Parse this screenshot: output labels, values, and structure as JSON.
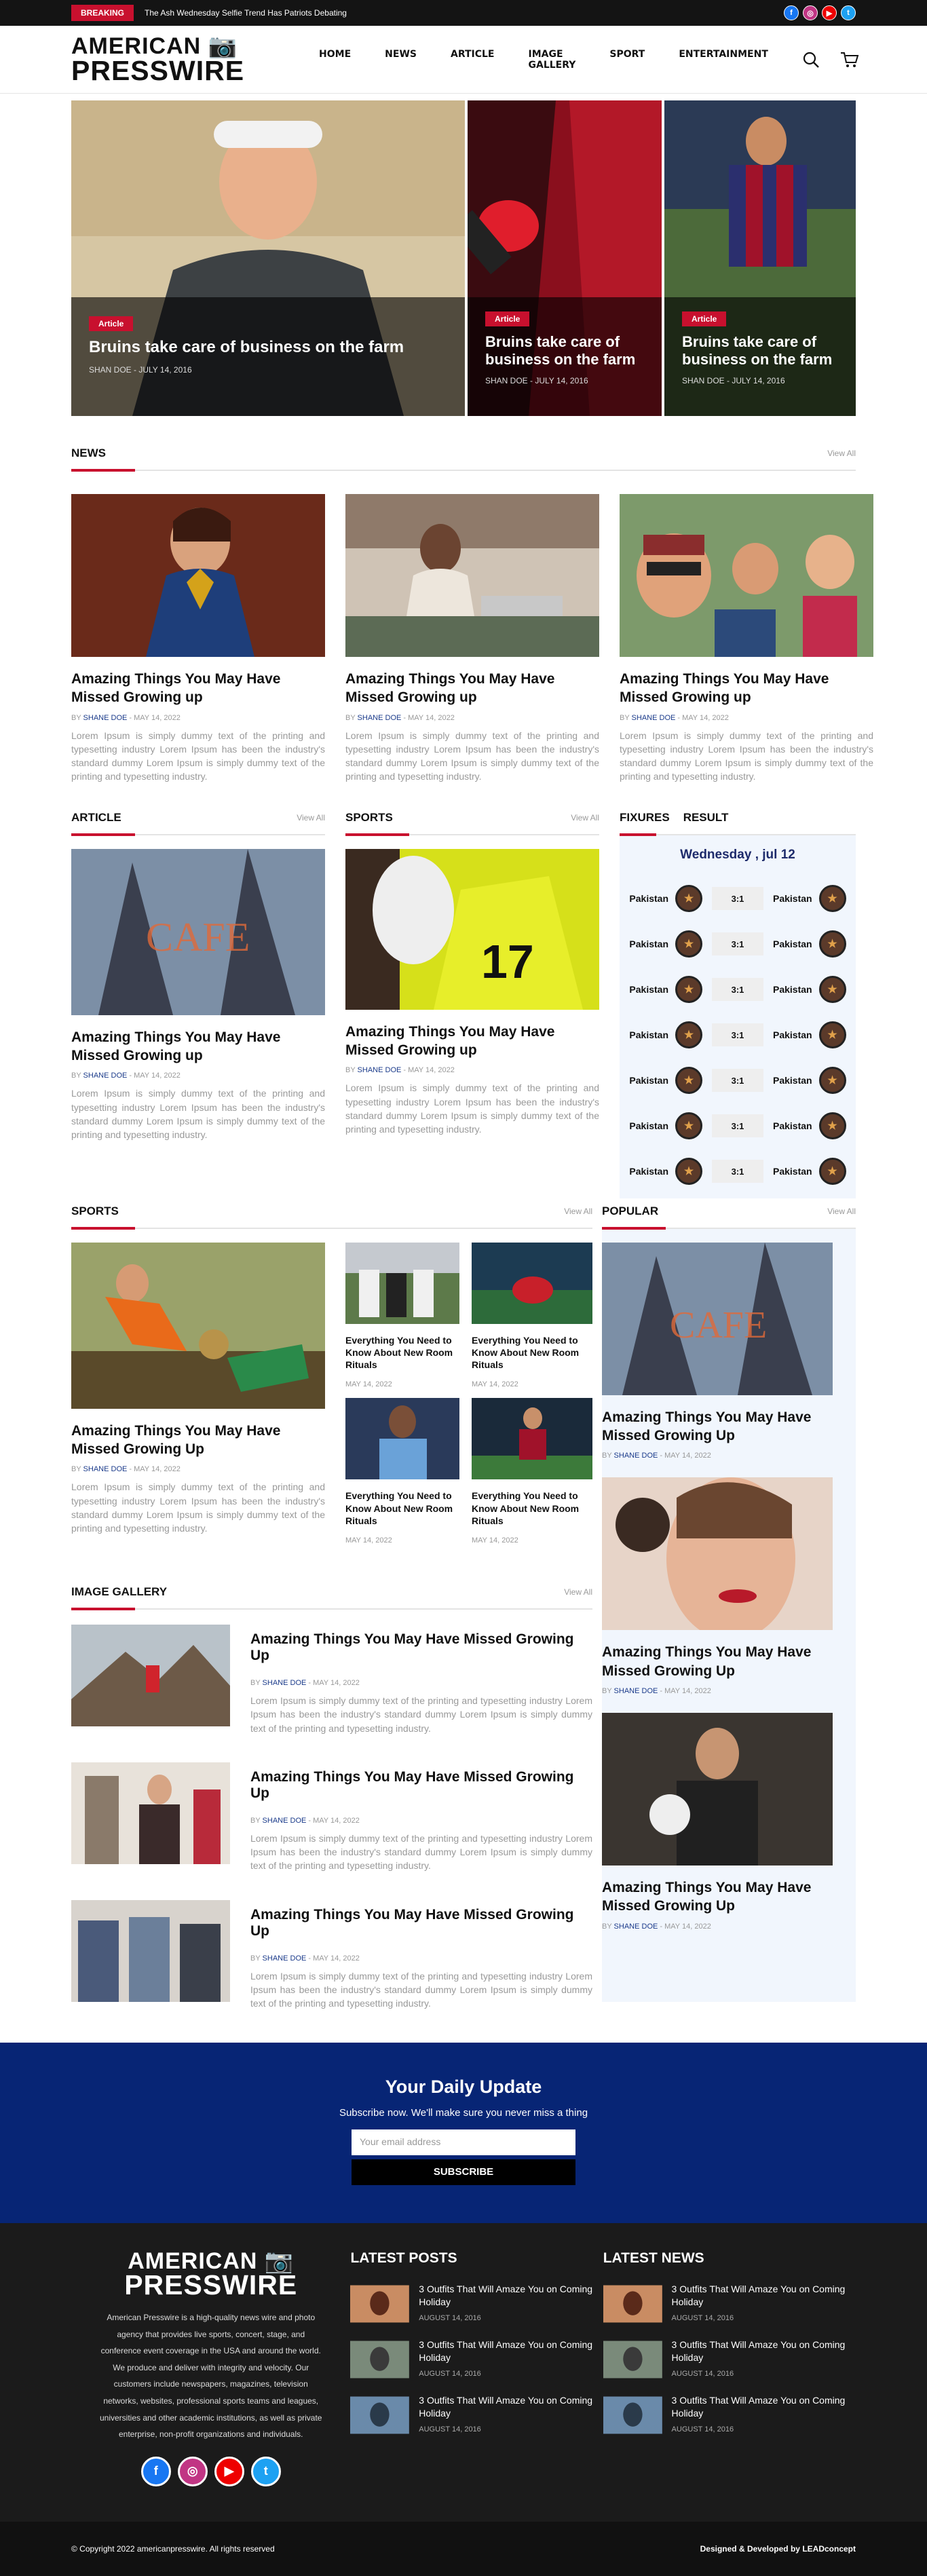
{
  "topbar": {
    "breaking": "BREAKING",
    "ticker": "The Ash Wednesday Selfie Trend Has Patriots Debating",
    "socials": [
      "f",
      "ig",
      "yt",
      "tw"
    ]
  },
  "brand": {
    "line1": "AMERICAN",
    "line2": "PRESSWIRE",
    "accent": "#c8102e",
    "navy": "#072575"
  },
  "nav": [
    "HOME",
    "NEWS",
    "ARTICLE",
    "IMAGE GALLERY",
    "SPORT",
    "ENTERTAINMENT"
  ],
  "header_icons": [
    "search-icon",
    "cart-icon"
  ],
  "hero": [
    {
      "tag": "Article",
      "title": "Bruins take care of business on the farm",
      "meta": "SHAN DOE - JULY 14, 2016"
    },
    {
      "tag": "Article",
      "title": "Bruins take care of business on the farm",
      "meta": "SHAN DOE - JULY 14, 2016"
    },
    {
      "tag": "Article",
      "title": "Bruins take care of business on the farm",
      "meta": "SHAN DOE - JULY 14, 2016"
    }
  ],
  "common": {
    "view_all": "View All",
    "by": "BY",
    "author": "SHANE DOE",
    "date": " - MAY 14, 2022",
    "date_only": "MAY 14, 2022",
    "card_title": "Amazing Things You May Have Missed Growing up",
    "card_title_cap": "Amazing Things You May Have Missed Growing Up",
    "small_title": "Everything You Need to Know About New Room Rituals",
    "excerpt": "Lorem Ipsum is simply dummy text of the printing and typesetting industry Lorem Ipsum has been the industry's standard dummy Lorem Ipsum is simply dummy text of the printing and typesetting industry."
  },
  "sections": {
    "news": "NEWS",
    "article": "ARTICLE",
    "sports": "SPORTS",
    "fixtures": "FIXURES",
    "result": "RESULT",
    "sports2": "SPORTS",
    "popular": "POPULAR",
    "gallery": "IMAGE GALLERY"
  },
  "fixtures": {
    "date": "Wednesday , jul 12",
    "rows": [
      {
        "team1": "Pakistan",
        "score": "3:1",
        "team2": "Pakistan"
      },
      {
        "team1": "Pakistan",
        "score": "3:1",
        "team2": "Pakistan"
      },
      {
        "team1": "Pakistan",
        "score": "3:1",
        "team2": "Pakistan"
      },
      {
        "team1": "Pakistan",
        "score": "3:1",
        "team2": "Pakistan"
      },
      {
        "team1": "Pakistan",
        "score": "3:1",
        "team2": "Pakistan"
      },
      {
        "team1": "Pakistan",
        "score": "3:1",
        "team2": "Pakistan"
      },
      {
        "team1": "Pakistan",
        "score": "3:1",
        "team2": "Pakistan"
      }
    ]
  },
  "subscribe": {
    "title": "Your Daily Update",
    "text": "Subscribe now. We'll make sure you never miss a thing",
    "placeholder": "Your email address",
    "button": "SUBSCRIBE"
  },
  "footer": {
    "about": "American Presswire is a high-quality news wire and photo agency that provides live sports, concert, stage, and conference event coverage in the USA and around the world. We produce and deliver with integrity and velocity. Our customers include newspapers, magazines, television networks, websites, professional sports teams and leagues, universities and other academic institutions, as well as private enterprise, non-profit organizations and individuals.",
    "latest_posts": "LATEST POSTS",
    "latest_news": "LATEST NEWS",
    "post_title": "3 Outfits That Will Amaze You on Coming Holiday",
    "post_date": "AUGUST 14, 2016"
  },
  "copyright": {
    "left": "© Copyright 2022 americanpresswire. All rights reserved",
    "right": "Designed & Developed by LEADconcept"
  }
}
